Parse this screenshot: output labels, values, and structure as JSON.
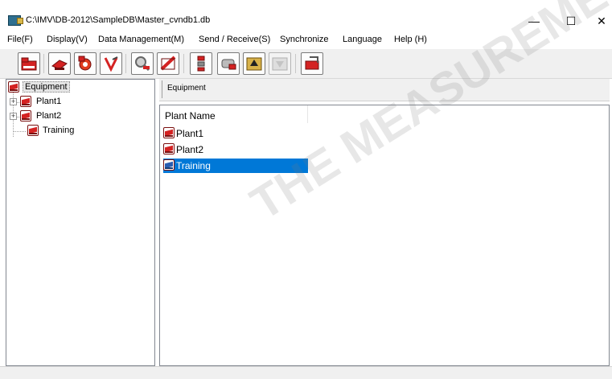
{
  "window": {
    "title": "C:\\IMV\\DB-2012\\SampleDB\\Master_cvndb1.db",
    "minimize_symbol": "—",
    "maximize_symbol": "☐",
    "close_symbol": "✕"
  },
  "menu": {
    "items": [
      "File(F)",
      "Display(V)",
      "Data Management(M)",
      "Send / Receive(S)",
      "Synchronize",
      "Language",
      "Help (H)"
    ]
  },
  "toolbar": {
    "buttons": [
      {
        "icon": "open-database-icon",
        "enabled": true
      },
      {
        "icon": "machine-icon",
        "enabled": true
      },
      {
        "icon": "settings-gear-icon",
        "enabled": true
      },
      {
        "icon": "measure-tool-icon",
        "enabled": true
      },
      {
        "icon": "search-icon",
        "enabled": true
      },
      {
        "icon": "route-card-icon",
        "enabled": true
      },
      {
        "icon": "sensor-tree-icon",
        "enabled": true
      },
      {
        "icon": "transfer-icon",
        "enabled": true
      },
      {
        "icon": "upload-folder-icon",
        "enabled": true
      },
      {
        "icon": "download-folder-icon",
        "enabled": false
      },
      {
        "icon": "export-icon",
        "enabled": true
      }
    ]
  },
  "tree": {
    "root_label": "Equipment",
    "nodes": [
      {
        "label": "Plant1",
        "expandable": true
      },
      {
        "label": "Plant2",
        "expandable": true
      },
      {
        "label": "Training",
        "expandable": false
      }
    ]
  },
  "header": {
    "label": "Equipment"
  },
  "list": {
    "column_header": "Plant Name",
    "rows": [
      {
        "label": "Plant1",
        "selected": false
      },
      {
        "label": "Plant2",
        "selected": false
      },
      {
        "label": "Training",
        "selected": true
      }
    ]
  },
  "colors": {
    "selection": "#0078d7",
    "db_icon_red": "#d42222",
    "db_icon_blue": "#2a5db0"
  }
}
